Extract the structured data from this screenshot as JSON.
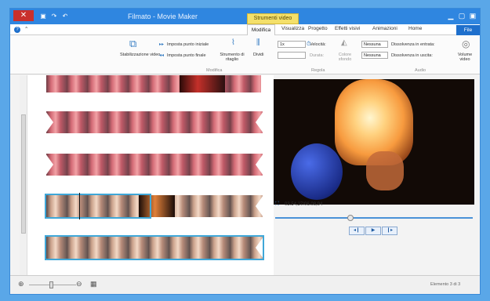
{
  "titlebar": {
    "title": "Filmato - Movie Maker",
    "close_glyph": "✕",
    "contextual_tab": "Strumenti video"
  },
  "tabs": {
    "file": "File",
    "home": "Home",
    "animations": "Animazioni",
    "visual_effects": "Effetti visivi",
    "project": "Progetto",
    "view": "Visualizza",
    "edit": "Modifica"
  },
  "ribbon": {
    "volume": "Volume video",
    "fade_in_label": "Dissolvenza in entrata:",
    "fade_in_value": "Nessuna",
    "fade_out_label": "Dissolvenza in uscita:",
    "fade_out_value": "Nessuna",
    "background_color": "Colore sfondo",
    "speed_label": "Velocità:",
    "speed_value": "1x",
    "duration_label": "Durata:",
    "split": "Dividi",
    "trim_tool": "Strumento di ritaglio",
    "set_start": "Imposta punto iniziale",
    "set_end": "Imposta punto finale",
    "stabilization": "Stabilizzazione video",
    "group_audio": "Audio",
    "group_settings": "Regola",
    "group_edit": "Modifica"
  },
  "preview": {
    "timecode": "03.54,27/06.08,94",
    "prev_frame": "◂❙",
    "play": "▶",
    "next_frame": "❙▸"
  },
  "status": {
    "item_count": "Elemento 3 di 3"
  },
  "icons": {
    "help": "help-icon",
    "zoom_in": "zoom-in-icon",
    "zoom_out": "zoom-out-icon",
    "thumbnail_size": "thumbnail-size-icon"
  }
}
